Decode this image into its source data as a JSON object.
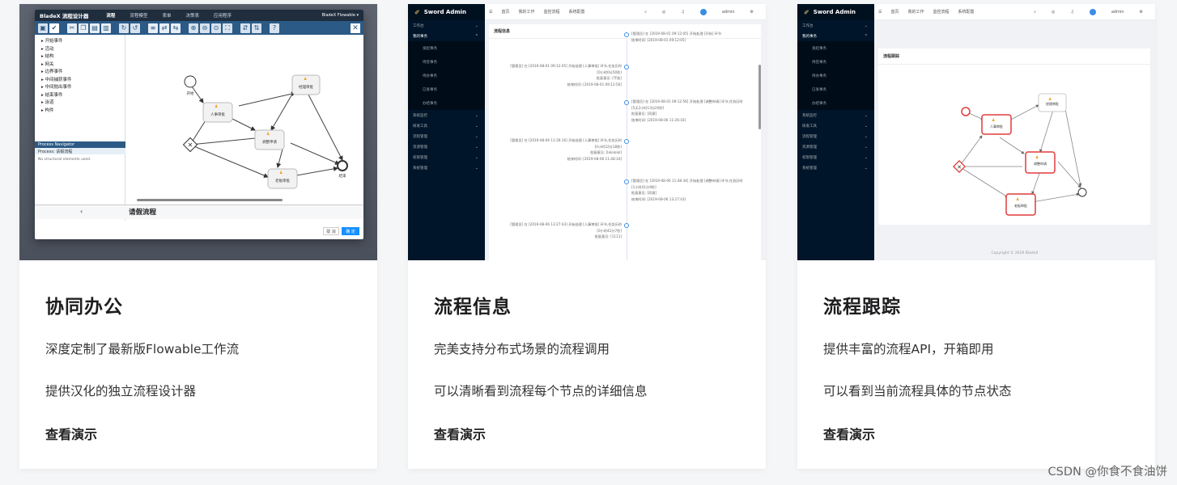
{
  "cards": [
    {
      "title": "协同办公",
      "lines": [
        "深度定制了最新版Flowable工作流",
        "提供汉化的独立流程设计器"
      ],
      "link": "查看演示",
      "screenshot": {
        "brand": "BladeX 流程设计器",
        "tabs": [
          "流程",
          "流程模型",
          "表单",
          "决策表",
          "应用程序"
        ],
        "user": "BladeX Flowable ▾",
        "palette": [
          "开始事件",
          "活动",
          "结构",
          "网关",
          "边界事件",
          "中间捕获事件",
          "中间抛出事件",
          "结束事件",
          "泳道",
          "构件"
        ],
        "navigator_title": "Process Navigator",
        "navigator_selected": "Process: 请假流程",
        "navigator_text": "No structural elements used.",
        "process_name": "请假流程",
        "prev_arrow": "‹",
        "cancel": "取 消",
        "confirm": "确 定",
        "nodes": [
          "人事审批",
          "经理审批",
          "调整申请",
          "老板审批"
        ],
        "start_label": "开始",
        "end_label": "结束"
      }
    },
    {
      "title": "流程信息",
      "lines": [
        "完美支持分布式场景的流程调用",
        "可以清晰看到流程每个节点的详细信息"
      ],
      "link": "查看演示",
      "screenshot": {
        "app": "Sword Admin",
        "header_links": [
          "首页",
          "我的工作",
          "监控流程",
          "系统配置"
        ],
        "user": "admin",
        "menu": [
          {
            "label": "工作台",
            "sub": false
          },
          {
            "label": "我的事务",
            "sub": false,
            "active": true
          },
          {
            "label": "发起事务",
            "sub": true
          },
          {
            "label": "待签事务",
            "sub": true
          },
          {
            "label": "待办事务",
            "sub": true
          },
          {
            "label": "已发事务",
            "sub": true
          },
          {
            "label": "办结事务",
            "sub": true
          },
          {
            "label": "系统监控",
            "sub": false
          },
          {
            "label": "研发工具",
            "sub": false
          },
          {
            "label": "流程管理",
            "sub": false
          },
          {
            "label": "资源管理",
            "sub": false
          },
          {
            "label": "权限管理",
            "sub": false
          },
          {
            "label": "系统管理",
            "sub": false
          }
        ],
        "panel_title": "流程信息",
        "timeline": [
          {
            "side": "r",
            "lines": [
              "[管理员] 在 [2019-08-01 09:12:05] 开始处理 [开始] 环节",
              "结束时间: [2019-08-01 09:12:05]"
            ]
          },
          {
            "side": "l",
            "lines": [
              "[管理员] 在 [2019-08-01 09:12:05] 开始处理 [人事审批] 环节,任务历时",
              "[0小时0分50秒]",
              "批复意见: [不准]",
              "结束时间: [2019-08-01 09:12:56]"
            ]
          },
          {
            "side": "r",
            "lines": [
              "[管理员] 在 [2019-08-01 09:12:56] 开始处理 [调整申请] 环节,任务历时",
              "[5天2小时13分20秒]",
              "批复意见: [同意]",
              "结束时间: [2019-08-06 11:26:16]"
            ]
          },
          {
            "side": "l",
            "lines": [
              "[管理员] 在 [2019-08-06 11:26:16] 开始处理 [人事审批] 环节,任务历时",
              "[0小时22分18秒]",
              "批复意见: [lolololol]",
              "结束时间: [2019-08-06 11:48:34]"
            ]
          },
          {
            "side": "r",
            "lines": [
              "[管理员] 在 [2019-08-06 11:48:34] 开始处理 [调整申请] 环节,任务历时",
              "[1小时41分9秒]",
              "批复意见: [同意]",
              "结束时间: [2019-08-06 13:27:43]"
            ]
          },
          {
            "side": "l",
            "lines": [
              "[管理员] 在 [2019-08-06 13:27:43] 开始处理 [人事审批] 环节,任务历时",
              "[0小时42分7秒]",
              "批复意见: [1111]"
            ]
          }
        ]
      }
    },
    {
      "title": "流程跟踪",
      "lines": [
        "提供丰富的流程API，开箱即用",
        "可以看到当前流程具体的节点状态"
      ],
      "link": "查看演示",
      "screenshot": {
        "app": "Sword Admin",
        "header_links": [
          "首页",
          "我的工作",
          "监控流程",
          "系统配置"
        ],
        "user": "admin",
        "panel_title": "流程跟踪",
        "copyright": "Copyright © 2019 BladeX",
        "nodes": [
          "人事审批",
          "经理审批",
          "调整申请",
          "老板审批"
        ]
      }
    }
  ],
  "watermark": "CSDN @你食不食油饼"
}
